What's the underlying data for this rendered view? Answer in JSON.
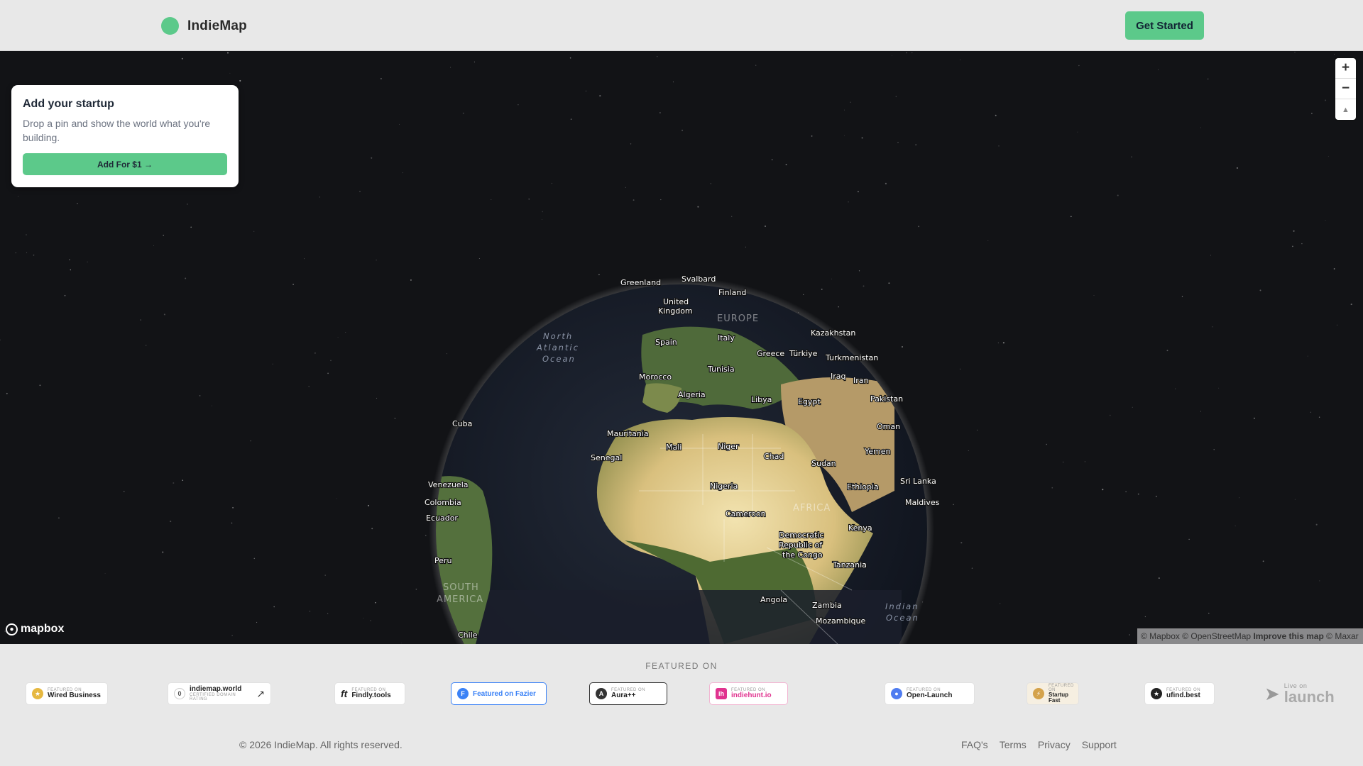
{
  "header": {
    "brand": "IndieMap",
    "cta_label": "Get Started"
  },
  "card": {
    "title": "Add your startup",
    "description": "Drop a pin and show the world what you're building.",
    "button_label": "Add For $1 →"
  },
  "map_controls": {
    "zoom_in": "+",
    "zoom_out": "−",
    "compass": "▲"
  },
  "mapbox_logo": "mapbox",
  "attribution": {
    "mapbox": "© Mapbox",
    "osm": "© OpenStreetMap",
    "improve": "Improve this map",
    "maxar": "© Maxar"
  },
  "globe_labels": {
    "countries": [
      "Greenland",
      "Svalbard",
      "Finland",
      "United",
      "Kingdom",
      "Spain",
      "Italy",
      "Kazakhstan",
      "Greece",
      "Türkiye",
      "Turkmenistan",
      "Tunisia",
      "Morocco",
      "Iraq",
      "Iran",
      "Algeria",
      "Libya",
      "Egypt",
      "Pakistan",
      "Oman",
      "Cuba",
      "Mauritania",
      "Mali",
      "Niger",
      "Senegal",
      "Chad",
      "Sudan",
      "Yemen",
      "Venezuela",
      "Nigeria",
      "Ethiopia",
      "Sri Lanka",
      "Colombia",
      "Maldives",
      "Ecuador",
      "Cameroon",
      "Kenya",
      "Democratic",
      "Republic of",
      "the Congo",
      "Tanzania",
      "Peru",
      "Angola",
      "Zambia",
      "Mozambique",
      "Chile"
    ],
    "oceans": [
      "North",
      "Atlantic",
      "Ocean",
      "Indian",
      "Ocean"
    ],
    "continents": [
      "EUROPE",
      "AFRICA",
      "SOUTH",
      "AMERICA"
    ]
  },
  "featured": {
    "title": "FEATURED ON",
    "badges": [
      {
        "small": "FEATURED ON",
        "name": "Wired Business",
        "icon": "ribbon-icon",
        "color": "#e6b840"
      },
      {
        "small": "CERTIFIED DOMAIN RATING",
        "name": "indiemap.world",
        "icon": "trend-icon",
        "color": "#555555",
        "count": "0"
      },
      {
        "small": "FEATURED ON",
        "name": "Findly.tools",
        "icon": "ft-icon",
        "color": "#222222"
      },
      {
        "small": "",
        "name": "Featured on Fazier",
        "icon": "fazier-icon",
        "color": "#3b82f6"
      },
      {
        "small": "FEATURED ON",
        "name": "Aura++",
        "icon": "aura-icon",
        "color": "#333333"
      },
      {
        "small": "FEATURED ON",
        "name": "indiehunt.io",
        "icon": "ih-icon",
        "color": "#e0338f"
      },
      {
        "small": "FEATURED ON",
        "name": "Open-Launch",
        "icon": "open-launch-icon",
        "color": "#4f7cf0"
      },
      {
        "small": "FEATURED ON",
        "name": "Startup Fast",
        "icon": "startup-fast-icon",
        "color": "#d4a24a"
      },
      {
        "small": "FEATURED ON",
        "name": "ufind.best",
        "icon": "star-icon",
        "color": "#222222"
      },
      {
        "small": "Live on",
        "name": "launch",
        "icon": "paper-plane-icon",
        "color": "#999999"
      }
    ]
  },
  "footer": {
    "copyright": "© 2026 IndieMap. All rights reserved.",
    "links": [
      "FAQ's",
      "Terms",
      "Privacy",
      "Support"
    ]
  }
}
